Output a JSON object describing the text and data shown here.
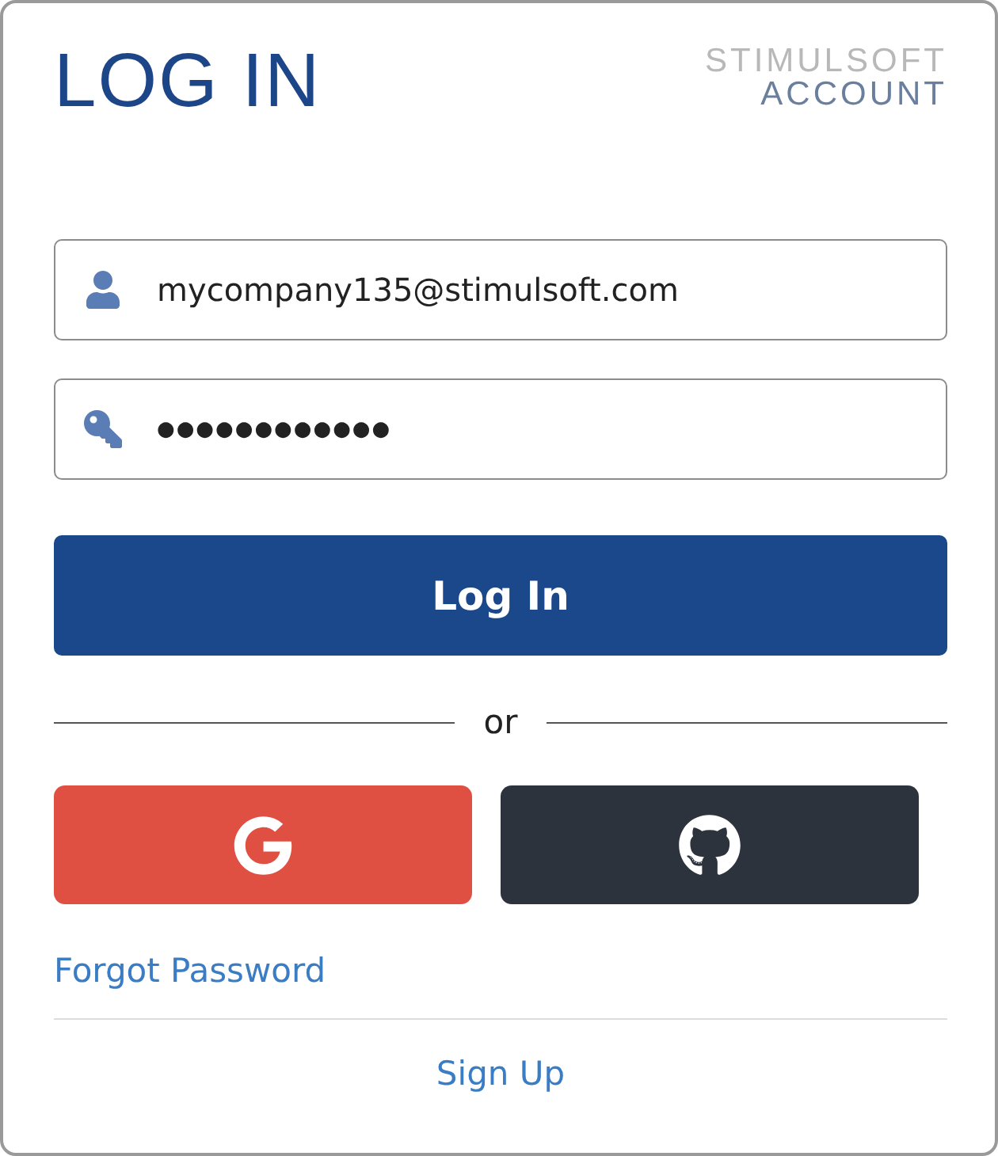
{
  "title": "LOG IN",
  "brand": {
    "line_1": "STIMULSOFT",
    "line_2": "ACCOUNT"
  },
  "fields": [
    {
      "kind": "user",
      "value": "mycompany135@stimulsoft.com"
    },
    {
      "kind": "key",
      "value": "●●●●●●●●●●●●"
    }
  ],
  "login_button": "Log In",
  "divider_text": "or",
  "social_buttons": [
    {
      "kind": "google"
    },
    {
      "kind": "github"
    }
  ],
  "forgot_link": "Forgot Password",
  "signup_link": "Sign Up"
}
